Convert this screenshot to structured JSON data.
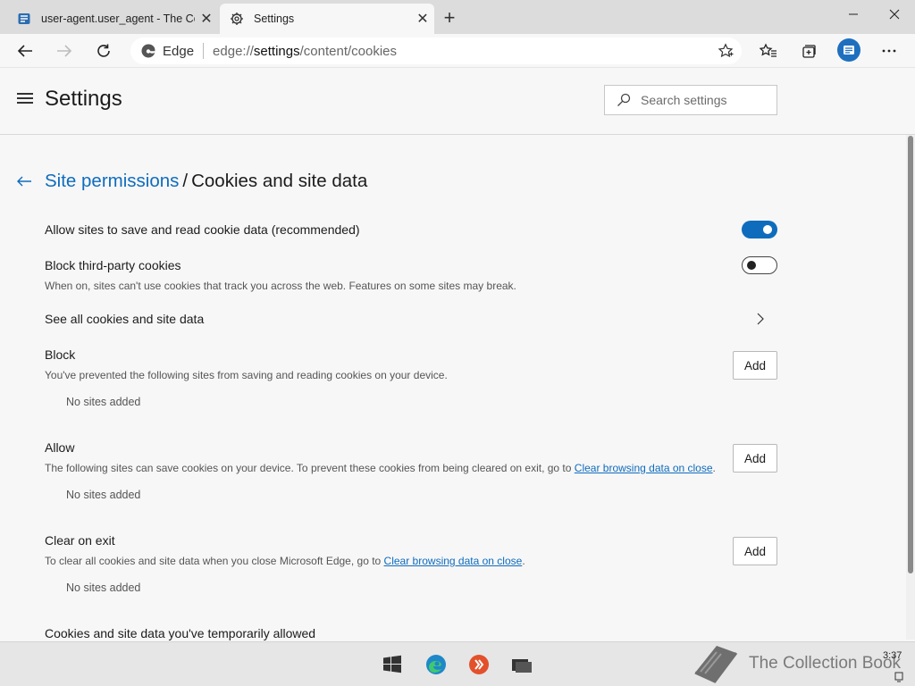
{
  "tabs": [
    {
      "title": "user-agent.user_agent - The Coll",
      "icon": "book-icon",
      "active": false
    },
    {
      "title": "Settings",
      "icon": "gear-icon",
      "active": true
    }
  ],
  "toolbar": {
    "brand": "Edge",
    "url_scheme": "edge://",
    "url_host": "settings",
    "url_path": "/content/cookies"
  },
  "settings": {
    "title": "Settings",
    "search_placeholder": "Search settings"
  },
  "breadcrumb": {
    "parent": "Site permissions",
    "separator": "/",
    "current": "Cookies and site data"
  },
  "rows": {
    "allow_cookies": {
      "title": "Allow sites to save and read cookie data (recommended)",
      "enabled": true
    },
    "block_third_party": {
      "title": "Block third-party cookies",
      "description": "When on, sites can't use cookies that track you across the web. Features on some sites may break.",
      "enabled": false
    },
    "see_all": {
      "title": "See all cookies and site data"
    },
    "block": {
      "title": "Block",
      "description": "You've prevented the following sites from saving and reading cookies on your device.",
      "button": "Add",
      "empty": "No sites added"
    },
    "allow": {
      "title": "Allow",
      "description_prefix": "The following sites can save cookies on your device. To prevent these cookies from being cleared on exit, go to ",
      "link": "Clear browsing data on close",
      "description_suffix": ".",
      "button": "Add",
      "empty": "No sites added"
    },
    "clear_on_exit": {
      "title": "Clear on exit",
      "description_prefix": "To clear all cookies and site data when you close Microsoft Edge, go to ",
      "link": "Clear browsing data on close",
      "description_suffix": ".",
      "button": "Add",
      "empty": "No sites added"
    },
    "temporarily_allowed": {
      "title": "Cookies and site data you've temporarily allowed"
    }
  },
  "taskbar": {
    "watermark": "The Collection Book",
    "clock": "3:37"
  },
  "colors": {
    "accent": "#0f6cbd",
    "background": "#f7f7f7",
    "tabstrip": "#dcdcdc"
  }
}
